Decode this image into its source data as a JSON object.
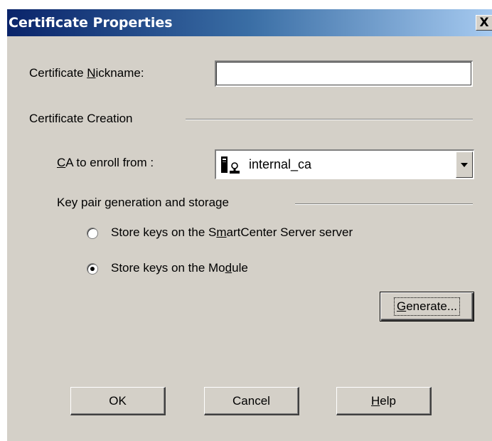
{
  "dialog": {
    "title": "Certificate Properties",
    "close_label": "X"
  },
  "nickname": {
    "label_before": "Certificate ",
    "label_mnemonic": "N",
    "label_after": "ickname:",
    "value": ""
  },
  "creation": {
    "heading": "Certificate Creation"
  },
  "ca": {
    "label_mnemonic": "C",
    "label_after": "A to enroll from :",
    "selected": "internal_ca",
    "icon": "ca-server-icon"
  },
  "keypair": {
    "heading": "Key pair generation and storage",
    "options": [
      {
        "before": "Store keys on the S",
        "mnemonic": "m",
        "after": "artCenter Server server",
        "checked": false
      },
      {
        "before": "Store keys on the Mo",
        "mnemonic": "d",
        "after": "ule",
        "checked": true
      }
    ],
    "generate_mnemonic": "G",
    "generate_after": "enerate..."
  },
  "footer": {
    "ok_label": "OK",
    "cancel_label": "Cancel",
    "help_mnemonic": "H",
    "help_after": "elp"
  },
  "colors": {
    "face": "#d4d0c8",
    "title_start": "#0a246a",
    "title_end": "#a6caf0"
  }
}
